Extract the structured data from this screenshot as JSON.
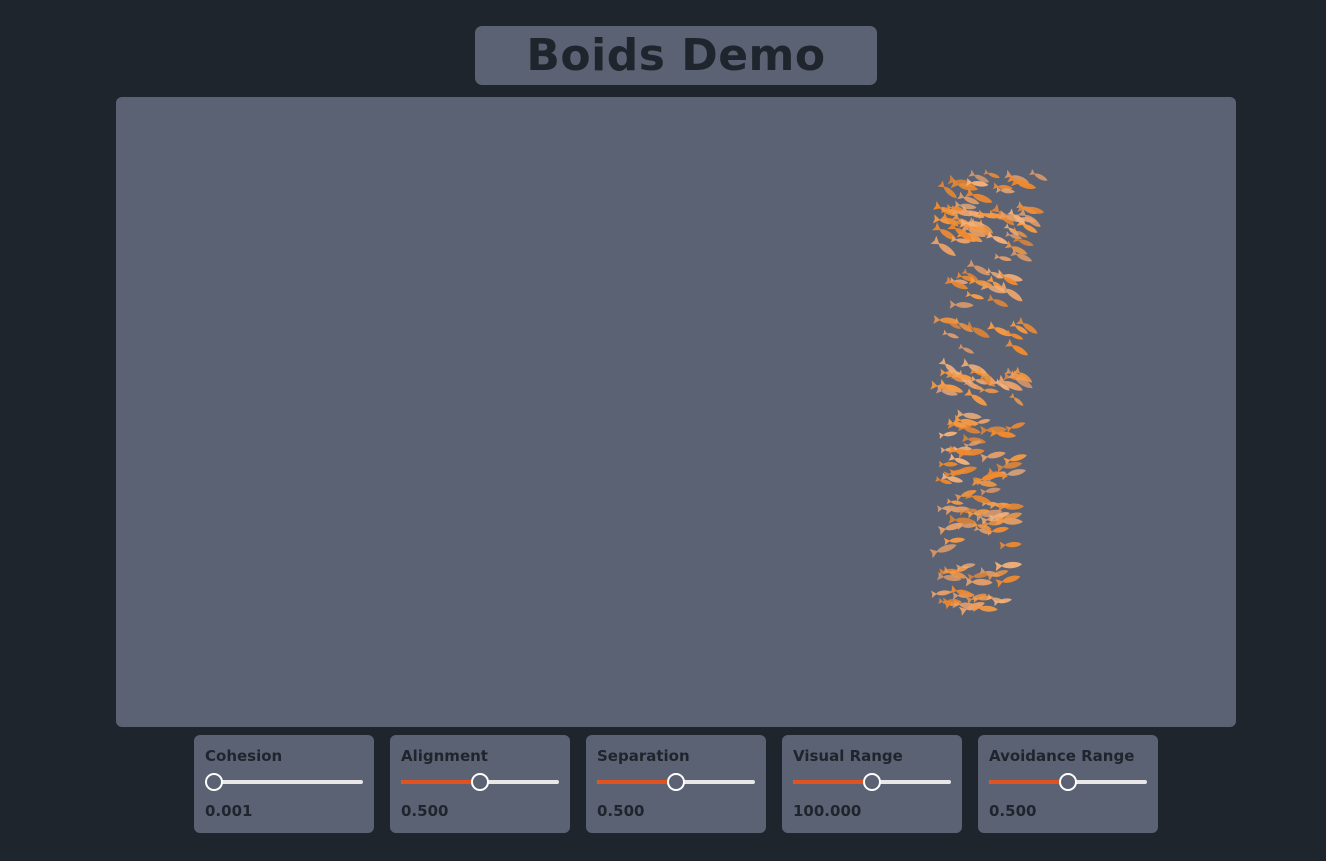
{
  "title": "Boids Demo",
  "colors": {
    "background": "#1f252d",
    "panel": "#5b6273",
    "accent": "#e0521f",
    "boid_primary": "#f08a30",
    "boid_light": "#f2b07a",
    "text_dark": "#1f252d"
  },
  "controls": [
    {
      "label": "Cohesion",
      "value": "0.001",
      "fraction": 0.0
    },
    {
      "label": "Alignment",
      "value": "0.500",
      "fraction": 0.5
    },
    {
      "label": "Separation",
      "value": "0.500",
      "fraction": 0.5
    },
    {
      "label": "Visual Range",
      "value": "100.000",
      "fraction": 0.5
    },
    {
      "label": "Avoidance Range",
      "value": "0.500",
      "fraction": 0.5
    }
  ]
}
